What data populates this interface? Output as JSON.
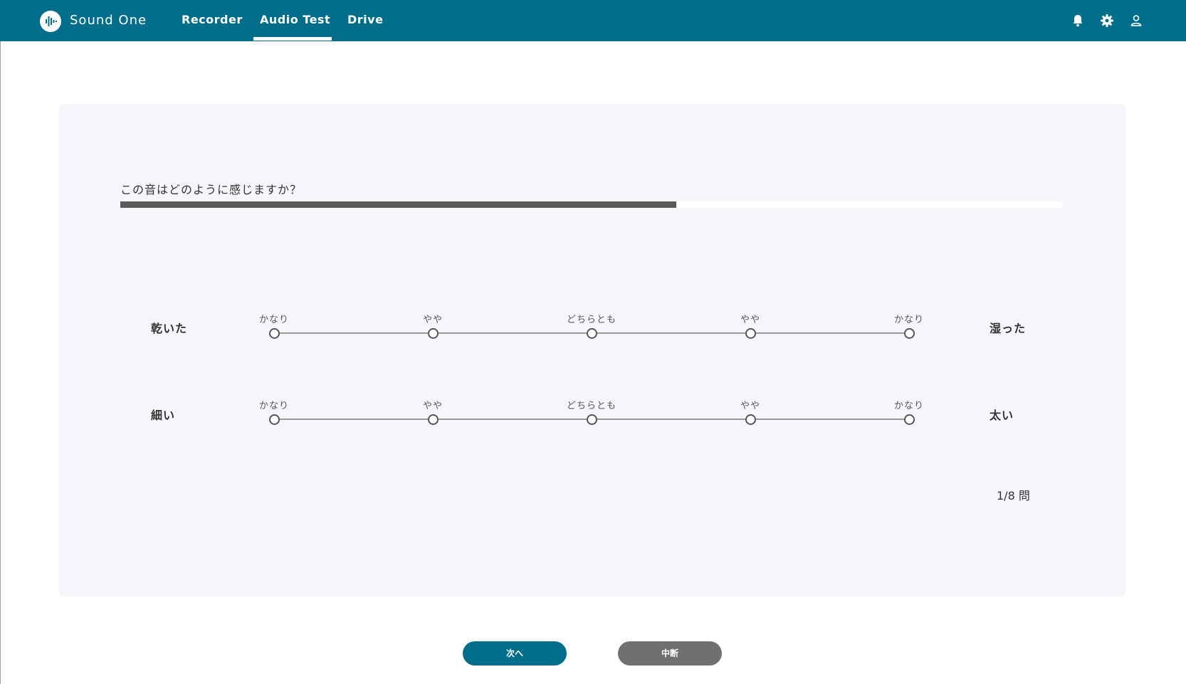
{
  "header": {
    "brand": "Sound One",
    "tabs": [
      {
        "label": "Recorder",
        "active": false
      },
      {
        "label": "Audio Test",
        "active": true
      },
      {
        "label": "Drive",
        "active": false
      }
    ],
    "icons": [
      "bell-icon",
      "gear-icon",
      "user-icon"
    ],
    "color": "#006e8a"
  },
  "survey": {
    "question": "この音はどのように感じますか？",
    "progress": 0.59,
    "scale_labels": [
      "かなり",
      "やや",
      "どちらとも",
      "やや",
      "かなり"
    ],
    "rows": [
      {
        "left": "乾いた",
        "right": "湿った"
      },
      {
        "left": "細い",
        "right": "太い"
      }
    ],
    "counter": "1/8 問"
  },
  "buttons": {
    "next": "次へ",
    "abort": "中断"
  }
}
